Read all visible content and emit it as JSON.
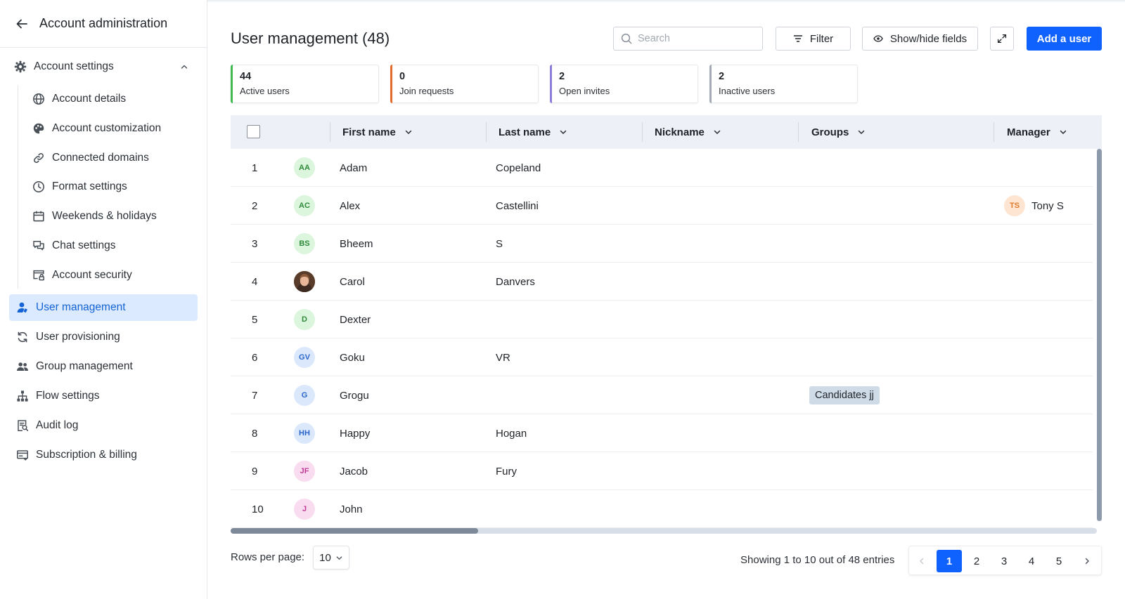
{
  "sidebar": {
    "title": "Account administration",
    "group": {
      "label": "Account settings",
      "expanded": true
    },
    "sub_items": [
      {
        "label": "Account details",
        "icon": "globe-icon"
      },
      {
        "label": "Account customization",
        "icon": "palette-icon"
      },
      {
        "label": "Connected domains",
        "icon": "link-icon"
      },
      {
        "label": "Format settings",
        "icon": "clock-icon"
      },
      {
        "label": "Weekends & holidays",
        "icon": "calendar-icon"
      },
      {
        "label": "Chat settings",
        "icon": "chat-icon"
      },
      {
        "label": "Account security",
        "icon": "security-icon"
      }
    ],
    "items": [
      {
        "label": "User management",
        "icon": "user-icon",
        "active": true
      },
      {
        "label": "User provisioning",
        "icon": "sync-icon"
      },
      {
        "label": "Group management",
        "icon": "group-icon"
      },
      {
        "label": "Flow settings",
        "icon": "hierarchy-icon"
      },
      {
        "label": "Audit log",
        "icon": "audit-icon"
      },
      {
        "label": "Subscription & billing",
        "icon": "billing-icon"
      }
    ]
  },
  "header": {
    "title": "User management (48)",
    "search_placeholder": "Search",
    "filter_label": "Filter",
    "fields_label": "Show/hide fields",
    "add_label": "Add a user"
  },
  "stats": [
    {
      "value": "44",
      "label": "Active users",
      "color": "#3fb950"
    },
    {
      "value": "0",
      "label": "Join requests",
      "color": "#e36b2c"
    },
    {
      "value": "2",
      "label": "Open invites",
      "color": "#8b7fd9"
    },
    {
      "value": "2",
      "label": "Inactive users",
      "color": "#a3aab3"
    }
  ],
  "table": {
    "columns": [
      "First name",
      "Last name",
      "Nickname",
      "Groups",
      "Manager"
    ],
    "rows": [
      {
        "num": "1",
        "initials": "AA",
        "avatar_bg": "#dcf5dd",
        "avatar_fg": "#2f8a3a",
        "first": "Adam",
        "last": "Copeland",
        "group": "",
        "manager": ""
      },
      {
        "num": "2",
        "initials": "AC",
        "avatar_bg": "#dcf5dd",
        "avatar_fg": "#2f8a3a",
        "first": "Alex",
        "last": "Castellini",
        "group": "",
        "manager": "Tony S",
        "manager_initials": "TS"
      },
      {
        "num": "3",
        "initials": "BS",
        "avatar_bg": "#dcf5dd",
        "avatar_fg": "#2f8a3a",
        "first": "Bheem",
        "last": "S",
        "group": "",
        "manager": ""
      },
      {
        "num": "4",
        "initials": "",
        "avatar_bg": "#6b4a36",
        "avatar_fg": "#ffffff",
        "photo": true,
        "first": "Carol",
        "last": "Danvers",
        "group": "",
        "manager": ""
      },
      {
        "num": "5",
        "initials": "D",
        "avatar_bg": "#dcf5dd",
        "avatar_fg": "#2f8a3a",
        "first": "Dexter",
        "last": "",
        "group": "",
        "manager": ""
      },
      {
        "num": "6",
        "initials": "GV",
        "avatar_bg": "#dbe8fb",
        "avatar_fg": "#2a66c9",
        "first": "Goku",
        "last": "VR",
        "group": "",
        "manager": ""
      },
      {
        "num": "7",
        "initials": "G",
        "avatar_bg": "#dbe8fb",
        "avatar_fg": "#2a66c9",
        "first": "Grogu",
        "last": "",
        "group": "Candidates jj",
        "manager": ""
      },
      {
        "num": "8",
        "initials": "HH",
        "avatar_bg": "#dbe8fb",
        "avatar_fg": "#2a66c9",
        "first": "Happy",
        "last": "Hogan",
        "group": "",
        "manager": ""
      },
      {
        "num": "9",
        "initials": "JF",
        "avatar_bg": "#f9dcef",
        "avatar_fg": "#c03b95",
        "first": "Jacob",
        "last": "Fury",
        "group": "",
        "manager": ""
      },
      {
        "num": "10",
        "initials": "J",
        "avatar_bg": "#f9dcef",
        "avatar_fg": "#c03b95",
        "first": "John",
        "last": "",
        "group": "",
        "manager": ""
      }
    ]
  },
  "manager_avatar": {
    "bg": "#fde5d2",
    "fg": "#e07a2e"
  },
  "footer": {
    "rows_label": "Rows per page:",
    "rows_value": "10",
    "showing": "Showing 1 to 10 out of 48 entries",
    "pages": [
      "1",
      "2",
      "3",
      "4",
      "5"
    ],
    "current_page": "1"
  }
}
